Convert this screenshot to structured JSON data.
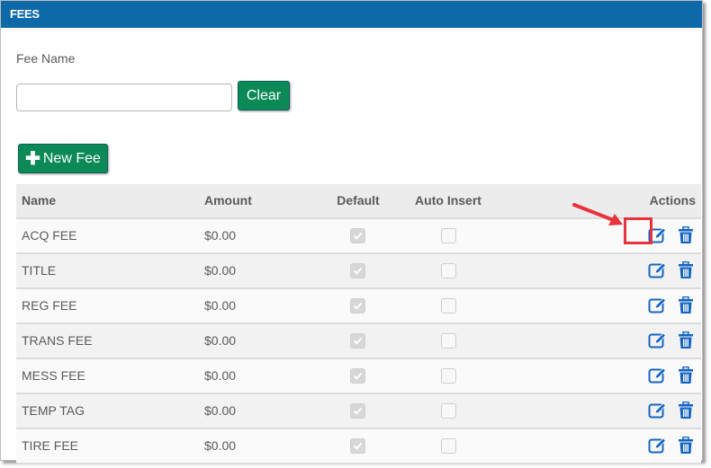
{
  "panel": {
    "title": "FEES"
  },
  "filter": {
    "label": "Fee Name",
    "value": "",
    "placeholder": "",
    "clear_label": "Clear"
  },
  "new_fee": {
    "icon": "plus-icon",
    "label": "New Fee"
  },
  "table": {
    "columns": [
      "Name",
      "Amount",
      "Default",
      "Auto Insert",
      "Actions"
    ],
    "rows": [
      {
        "name": "ACQ FEE",
        "amount": "$0.00",
        "default": true,
        "auto_insert": false
      },
      {
        "name": "TITLE",
        "amount": "$0.00",
        "default": true,
        "auto_insert": false
      },
      {
        "name": "REG FEE",
        "amount": "$0.00",
        "default": true,
        "auto_insert": false
      },
      {
        "name": "TRANS FEE",
        "amount": "$0.00",
        "default": true,
        "auto_insert": false
      },
      {
        "name": "MESS FEE",
        "amount": "$0.00",
        "default": true,
        "auto_insert": false
      },
      {
        "name": "TEMP TAG",
        "amount": "$0.00",
        "default": true,
        "auto_insert": false
      },
      {
        "name": "TIRE FEE",
        "amount": "$0.00",
        "default": true,
        "auto_insert": false
      }
    ],
    "action_icons": [
      "edit-icon",
      "trash-icon"
    ]
  },
  "annotation": {
    "highlight": "edit-button row 1",
    "color": "#e8323c"
  },
  "colors": {
    "header": "#0e69a9",
    "button": "#0b8a58",
    "icon": "#1565c0"
  }
}
